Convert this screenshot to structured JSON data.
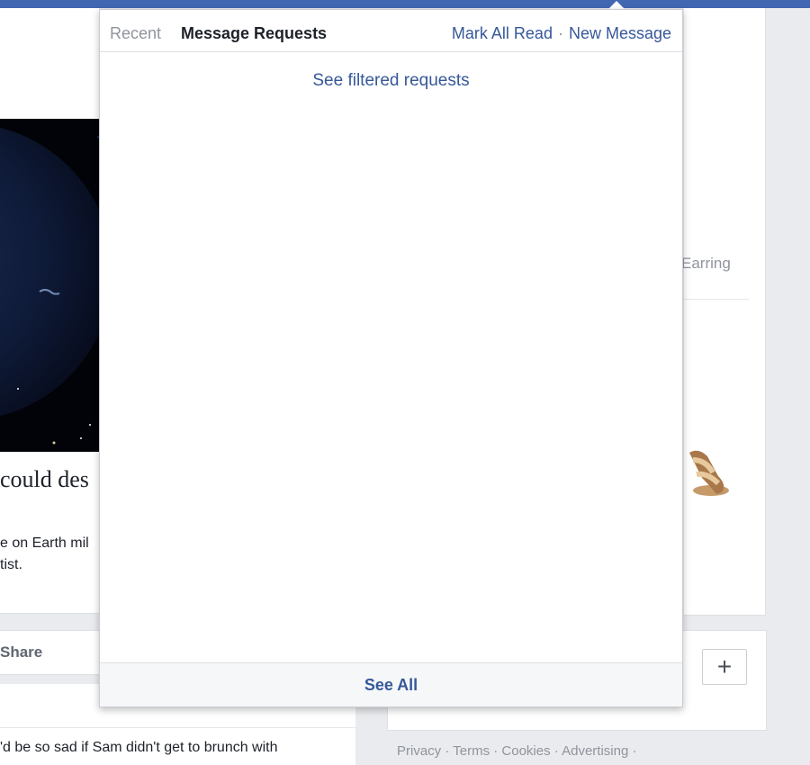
{
  "dropdown": {
    "tabs": {
      "recent": "Recent",
      "message_requests": "Message Requests"
    },
    "actions": {
      "mark_all_read": "Mark All Read",
      "separator": "·",
      "new_message": "New Message"
    },
    "filtered_link": "See filtered requests",
    "see_all": "See All"
  },
  "background": {
    "article": {
      "headline": "could des",
      "desc_line1": "e on Earth mil",
      "desc_line2": "tist."
    },
    "share_label": "Share",
    "post_snippet": "'d be so sad if Sam didn't get to brunch with",
    "sidebar": {
      "earring_text": "Earring",
      "add_button": "+",
      "footer_links": "Privacy · Terms · Cookies · Advertising ·"
    }
  },
  "colors": {
    "brand_blue": "#4267b2",
    "link_blue": "#365899",
    "muted_gray": "#90949c",
    "page_bg": "#e9ebee"
  }
}
